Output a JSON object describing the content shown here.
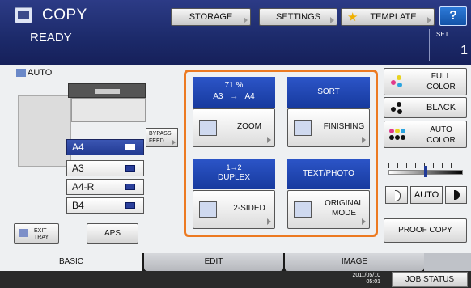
{
  "header": {
    "title": "COPY",
    "status": "READY",
    "buttons": {
      "storage": "STORAGE",
      "settings": "SETTINGS",
      "template": "TEMPLATE",
      "help": "?"
    },
    "set_label": "SET",
    "set_value": "1"
  },
  "left": {
    "auto_label": "AUTO",
    "bypass_line1": "BYPASS",
    "bypass_line2": "FEED",
    "trays": [
      "A4",
      "A3",
      "A4-R",
      "B4"
    ],
    "exit_line1": "EXIT",
    "exit_line2": "TRAY",
    "aps": "APS"
  },
  "functions": {
    "zoom_percent": "71 %",
    "zoom_ratio": "A3 → A4",
    "zoom": "ZOOM",
    "sort": "SORT",
    "finishing": "FINISHING",
    "duplex_top": "1→2",
    "duplex_bottom": "DUPLEX",
    "two_sided": "2-SIDED",
    "text_photo": "TEXT/PHOTO",
    "original_line1": "ORIGINAL",
    "original_line2": "MODE"
  },
  "right": {
    "full_line1": "FULL",
    "full_line2": "COLOR",
    "black": "BLACK",
    "auto_line1": "AUTO",
    "auto_line2": "COLOR",
    "density_auto": "AUTO",
    "density_level": 0.5,
    "proof": "PROOF COPY"
  },
  "tabs": {
    "basic": "BASIC",
    "edit": "EDIT",
    "image": "IMAGE"
  },
  "footer": {
    "date": "2011/05/10",
    "time": "05:01",
    "job_status": "JOB STATUS"
  },
  "colors": {
    "orange_group": "#ec7a22",
    "header_blue": "#1c2a6a",
    "function_blue": "#2c55c8"
  }
}
